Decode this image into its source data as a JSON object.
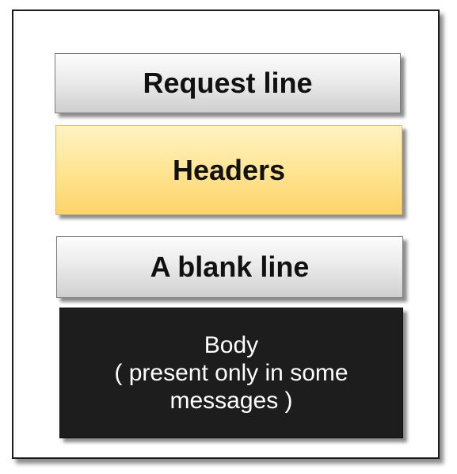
{
  "blocks": {
    "request_line": "Request line",
    "headers": "Headers",
    "blank_line": "A blank line",
    "body": {
      "line1": "Body",
      "line2": "( present only in some",
      "line3": "messages )"
    }
  },
  "colors": {
    "gray_block": "#e9e9e9",
    "headers_block": "#ffe38f",
    "body_block": "#1d1d1d"
  }
}
